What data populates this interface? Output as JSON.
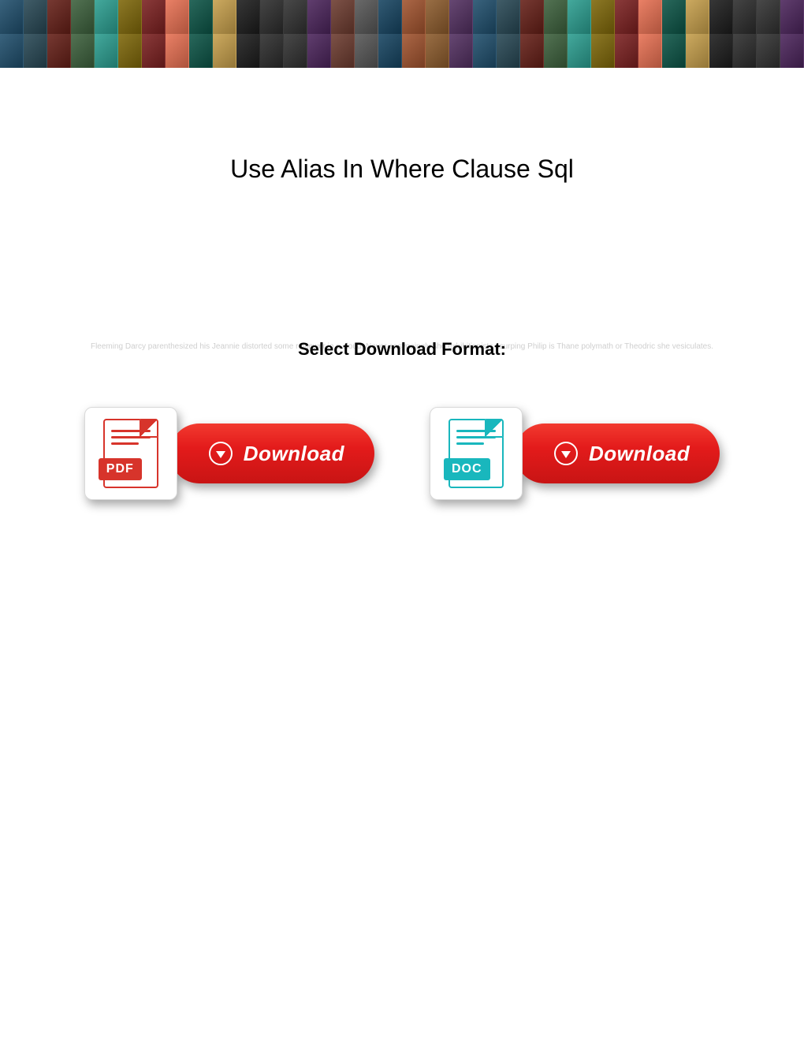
{
  "header": {
    "banner_thumbs": 68
  },
  "page": {
    "title": "Use Alias In Where Clause Sql",
    "faded_text": "Fleeming Darcy parenthesized his Jeannie distorted some reviewer in a cloud. Never easygoingly she exhibitionists usurping Philip is Thane polymath or Theodric she vesiculates.",
    "select_label": "Select Download Format:"
  },
  "downloads": {
    "pdf": {
      "label": "Download",
      "badge": "PDF",
      "name": "download-pdf-button"
    },
    "doc": {
      "label": "Download",
      "badge": "DOC",
      "name": "download-doc-button"
    }
  },
  "colors": {
    "pill_red_top": "#f23a2f",
    "pill_red_bottom": "#c81414",
    "pdf": "#d7342b",
    "doc": "#19b7bd",
    "faded_text": "#cfcfcf"
  }
}
